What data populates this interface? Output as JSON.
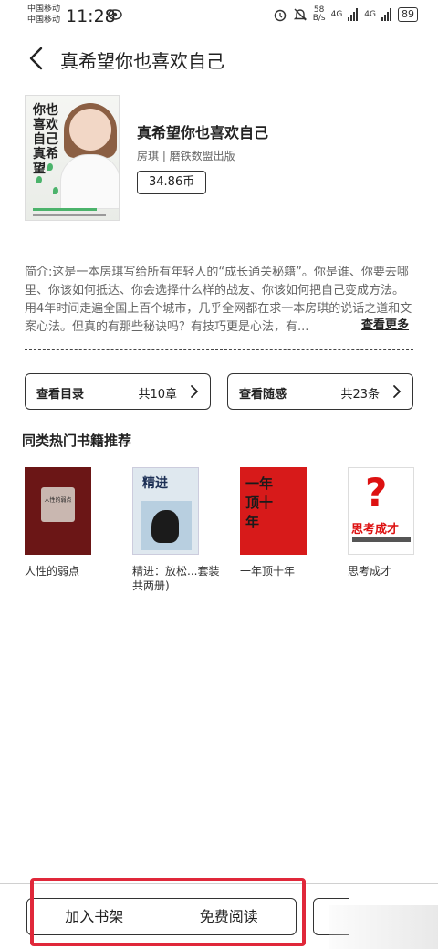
{
  "status_bar": {
    "carrier1": "中国移动",
    "carrier2": "中国移动",
    "time": "11:28",
    "net_speed_value": "58",
    "net_speed_unit": "B/s",
    "signal1": "4G",
    "signal2": "4G",
    "battery": "89"
  },
  "header": {
    "title": "真希望你也喜欢自己"
  },
  "book": {
    "title": "真希望你也喜欢自己",
    "meta": "房琪 | 磨铁数盟出版",
    "price": "34.86币",
    "cover_title": "你也喜欢自己真希望"
  },
  "intro": {
    "text": "简介:这是一本房琪写给所有年轻人的“成长通关秘籍”。你是谁、你要去哪里、你该如何抵达、你会选择什么样的战友、你该如何把自己变成方法。用4年时间走遍全国上百个城市，几乎全网都在求一本房琪的说话之道和文案心法。但真的有那些秘诀吗？有技巧更是心法，有...",
    "more_label": "查看更多"
  },
  "catalog_button": {
    "label": "查看目录",
    "count": "共10章"
  },
  "notes_button": {
    "label": "查看随感",
    "count": "共23条"
  },
  "recommend": {
    "title": "同类热门书籍推荐",
    "books": [
      {
        "name": "人性的弱点",
        "cover_text": "人性的弱点"
      },
      {
        "name": "精进：放松...套装共两册)",
        "cover_text": "精进"
      },
      {
        "name": "一年顶十年",
        "cover_text": "一年顶十年"
      },
      {
        "name": "思考成才",
        "cover_text": "思考成才"
      }
    ]
  },
  "bottom": {
    "add_shelf": "加入书架",
    "free_read": "免费阅读"
  },
  "colors": {
    "highlight": "#e0283a"
  }
}
